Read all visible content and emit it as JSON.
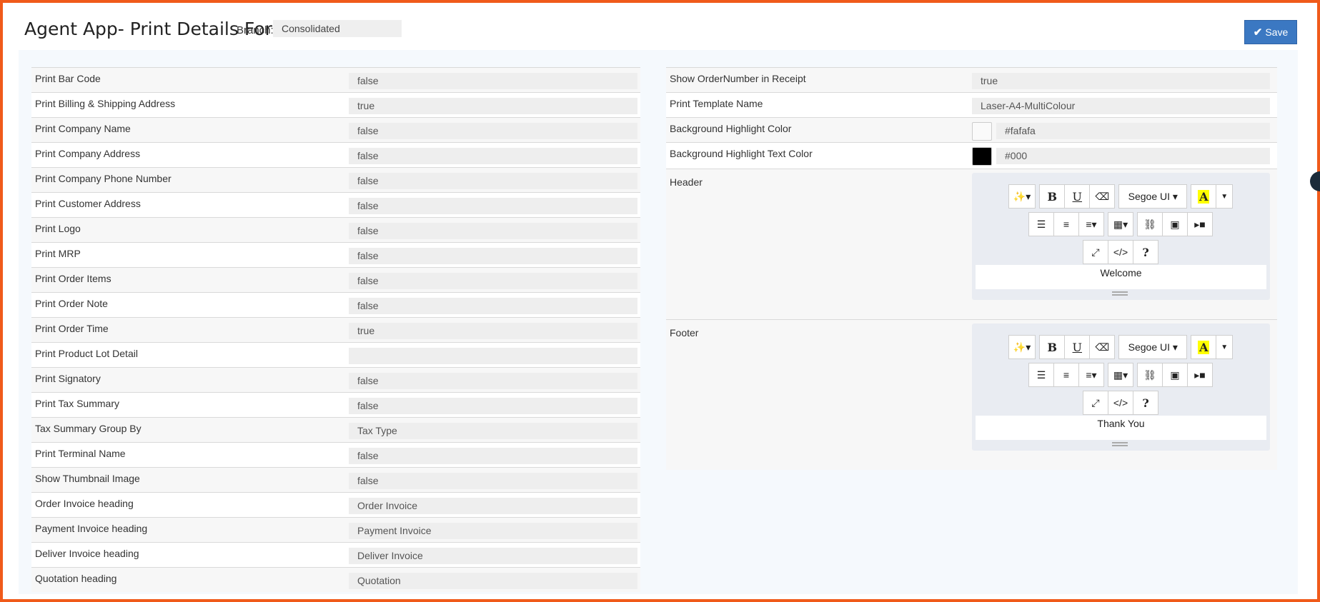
{
  "header": {
    "title": "Agent App- Print Details For",
    "branch_label": "Branch:",
    "branch_value": "Consolidated",
    "save_label": "Save"
  },
  "left_settings": [
    {
      "label": "Print Bar Code",
      "value": "false"
    },
    {
      "label": "Print Billing & Shipping Address",
      "value": "true"
    },
    {
      "label": "Print Company Name",
      "value": "false"
    },
    {
      "label": "Print Company Address",
      "value": "false"
    },
    {
      "label": "Print Company Phone Number",
      "value": "false"
    },
    {
      "label": "Print Customer Address",
      "value": "false"
    },
    {
      "label": "Print Logo",
      "value": "false"
    },
    {
      "label": "Print MRP",
      "value": "false"
    },
    {
      "label": "Print Order Items",
      "value": "false"
    },
    {
      "label": "Print Order Note",
      "value": "false"
    },
    {
      "label": "Print Order Time",
      "value": "true"
    },
    {
      "label": "Print Product Lot Detail",
      "value": ""
    },
    {
      "label": "Print Signatory",
      "value": "false"
    },
    {
      "label": "Print Tax Summary",
      "value": "false"
    },
    {
      "label": "Tax Summary Group By",
      "value": "Tax Type"
    },
    {
      "label": "Print Terminal Name",
      "value": "false"
    },
    {
      "label": "Show Thumbnail Image",
      "value": "false"
    },
    {
      "label": "Order Invoice heading",
      "value": "Order Invoice"
    },
    {
      "label": "Payment Invoice heading",
      "value": "Payment  Invoice"
    },
    {
      "label": "Deliver Invoice heading",
      "value": "Deliver Invoice"
    },
    {
      "label": "Quotation heading",
      "value": "Quotation"
    }
  ],
  "right_settings": {
    "show_order_number": {
      "label": "Show OrderNumber in Receipt",
      "value": "true"
    },
    "template_name": {
      "label": "Print Template Name",
      "value": "Laser-A4-MultiColour"
    },
    "bg_highlight": {
      "label": "Background Highlight Color",
      "value": "#fafafa",
      "swatch": "#fafafa"
    },
    "bg_highlight_text": {
      "label": "Background Highlight Text Color",
      "value": "#000",
      "swatch": "#000000"
    }
  },
  "editor_toolbar": {
    "font_name": "Segoe UI",
    "highlight_glyph": "A",
    "bold_glyph": "B",
    "underline_glyph": "U",
    "codeview_glyph": "</>",
    "help_glyph": "?"
  },
  "header_editor": {
    "label": "Header",
    "content": "Welcome"
  },
  "footer_editor": {
    "label": "Footer",
    "content": "Thank You"
  },
  "colors": {
    "accent": "#3b78c2",
    "frame": "#f05a1a",
    "panel": "#f5f9fd"
  }
}
